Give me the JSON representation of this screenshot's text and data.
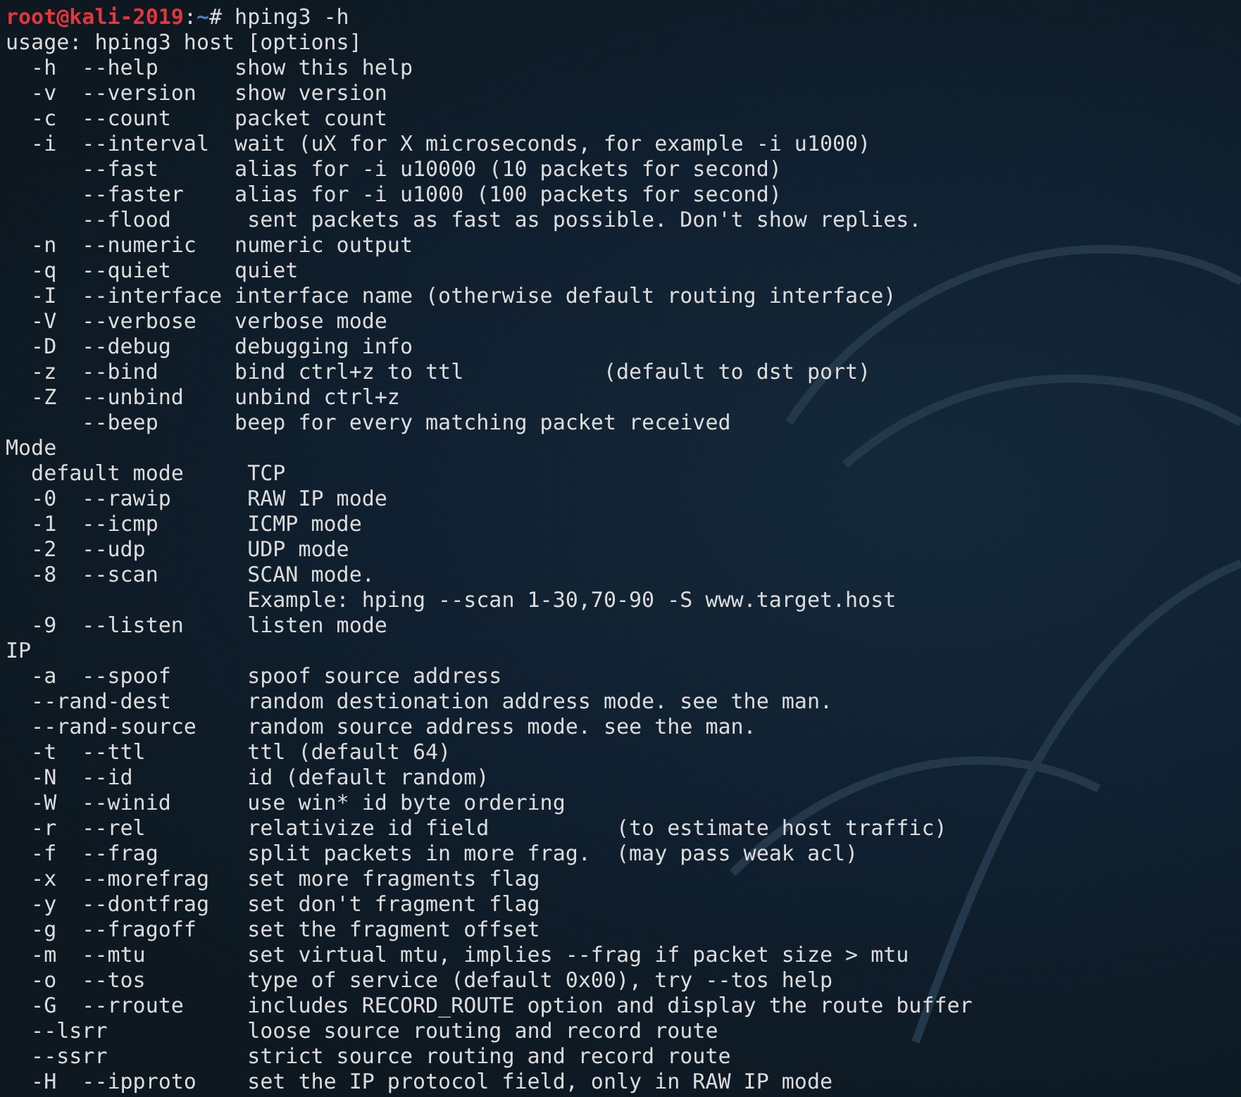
{
  "terminal": {
    "prompt": {
      "user_host": "root@kali-2019",
      "separator": ":",
      "path": "~",
      "symbol": "#",
      "command": "hping3 -h"
    },
    "output_lines": [
      "usage: hping3 host [options]",
      "  -h  --help      show this help",
      "  -v  --version   show version",
      "  -c  --count     packet count",
      "  -i  --interval  wait (uX for X microseconds, for example -i u1000)",
      "      --fast      alias for -i u10000 (10 packets for second)",
      "      --faster    alias for -i u1000 (100 packets for second)",
      "      --flood      sent packets as fast as possible. Don't show replies.",
      "  -n  --numeric   numeric output",
      "  -q  --quiet     quiet",
      "  -I  --interface interface name (otherwise default routing interface)",
      "  -V  --verbose   verbose mode",
      "  -D  --debug     debugging info",
      "  -z  --bind      bind ctrl+z to ttl           (default to dst port)",
      "  -Z  --unbind    unbind ctrl+z",
      "      --beep      beep for every matching packet received",
      "Mode",
      "  default mode     TCP",
      "  -0  --rawip      RAW IP mode",
      "  -1  --icmp       ICMP mode",
      "  -2  --udp        UDP mode",
      "  -8  --scan       SCAN mode.",
      "                   Example: hping --scan 1-30,70-90 -S www.target.host",
      "  -9  --listen     listen mode",
      "IP",
      "  -a  --spoof      spoof source address",
      "  --rand-dest      random destionation address mode. see the man.",
      "  --rand-source    random source address mode. see the man.",
      "  -t  --ttl        ttl (default 64)",
      "  -N  --id         id (default random)",
      "  -W  --winid      use win* id byte ordering",
      "  -r  --rel        relativize id field          (to estimate host traffic)",
      "  -f  --frag       split packets in more frag.  (may pass weak acl)",
      "  -x  --morefrag   set more fragments flag",
      "  -y  --dontfrag   set don't fragment flag",
      "  -g  --fragoff    set the fragment offset",
      "  -m  --mtu        set virtual mtu, implies --frag if packet size > mtu",
      "  -o  --tos        type of service (default 0x00), try --tos help",
      "  -G  --rroute     includes RECORD_ROUTE option and display the route buffer",
      "  --lsrr           loose source routing and record route",
      "  --ssrr           strict source routing and record route",
      "  -H  --ipproto    set the IP protocol field, only in RAW IP mode"
    ]
  }
}
